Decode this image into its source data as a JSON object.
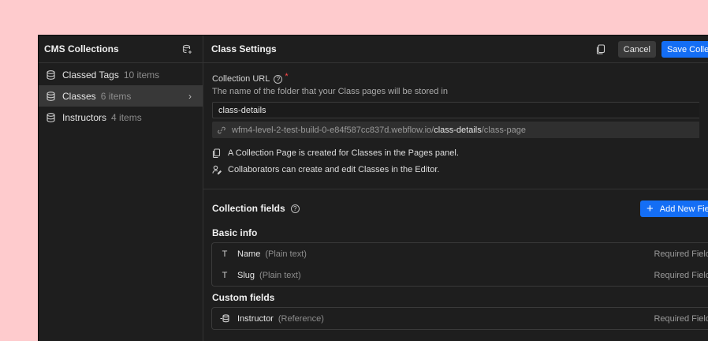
{
  "sidebar": {
    "title": "CMS Collections",
    "items": [
      {
        "label": "Classed Tags",
        "count": "10 items"
      },
      {
        "label": "Classes",
        "count": "6 items"
      },
      {
        "label": "Instructors",
        "count": "4 items"
      }
    ]
  },
  "header": {
    "title": "Class Settings",
    "cancel_label": "Cancel",
    "save_label": "Save Collection"
  },
  "url_section": {
    "label": "Collection URL",
    "hint": "The name of the folder that your Class pages will be stored in",
    "value": "class-details",
    "preview_prefix": "wfm4-level-2-test-build-0-e84f587cc837d.webflow.io/",
    "preview_bold": "class-details",
    "preview_suffix": "/class-page",
    "info1": "A Collection Page is created for Classes in the Pages panel.",
    "info2": "Collaborators can create and edit Classes in the Editor."
  },
  "fields": {
    "title": "Collection fields",
    "add_label": "Add New Field",
    "basic_title": "Basic info",
    "basic": [
      {
        "name": "Name",
        "type": "(Plain text)",
        "req": "Required Field"
      },
      {
        "name": "Slug",
        "type": "(Plain text)",
        "req": "Required Field"
      }
    ],
    "custom_title": "Custom fields",
    "custom": [
      {
        "name": "Instructor",
        "type": "(Reference)",
        "req": "Required Field"
      }
    ]
  }
}
